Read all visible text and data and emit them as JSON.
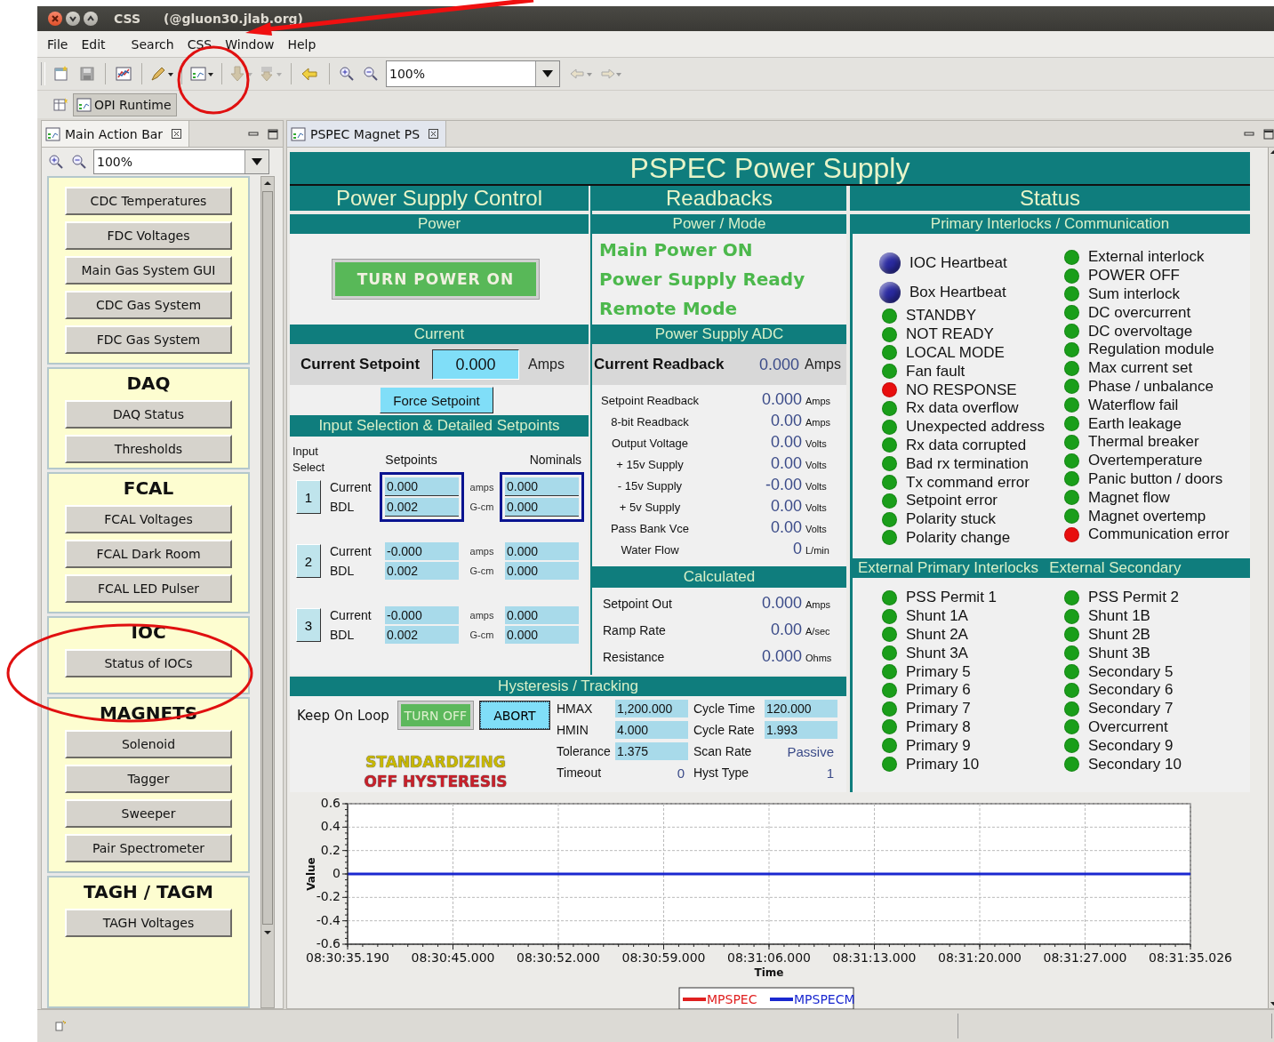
{
  "window": {
    "title": "CSS",
    "host": "(@gluon30.jlab.org)"
  },
  "menu": [
    "File",
    "Edit",
    "Search",
    "CSS",
    "Window",
    "Help"
  ],
  "toolbar": {
    "zoom": "100%"
  },
  "perspective": {
    "label": "OPI Runtime",
    "selected": true
  },
  "left_view": {
    "tab": "Main Action Bar",
    "zoom": "100%",
    "sections": [
      {
        "items": [
          "CDC Temperatures",
          "FDC Voltages",
          "Main Gas System GUI",
          "CDC Gas System",
          "FDC Gas System"
        ]
      },
      {
        "title": "DAQ",
        "items": [
          "DAQ Status",
          "Thresholds"
        ]
      },
      {
        "title": "FCAL",
        "items": [
          "FCAL Voltages",
          "FCAL Dark Room",
          "FCAL LED Pulser"
        ]
      },
      {
        "title": "IOC",
        "items": [
          "Status of IOCs"
        ]
      },
      {
        "title": "MAGNETS",
        "items": [
          "Solenoid",
          "Tagger",
          "Sweeper",
          "Pair Spectrometer"
        ]
      },
      {
        "title": "TAGH / TAGM",
        "items": [
          "TAGH Voltages"
        ]
      }
    ]
  },
  "editor": {
    "tab": "PSPEC Magnet PS",
    "title": "PSPEC Power Supply",
    "control": {
      "header": "Power Supply Control",
      "power_header": "Power",
      "power_button": "TURN POWER ON",
      "current_header": "Current",
      "setpoint_label": "Current Setpoint",
      "setpoint_value": "0.000",
      "setpoint_unit": "Amps",
      "force_button": "Force Setpoint",
      "input_header": "Input Selection & Detailed Setpoints",
      "input_select_label": "Input Select",
      "setpoints_label": "Setpoints",
      "nominals_label": "Nominals",
      "inputs": [
        {
          "button": "1",
          "selected": true,
          "rows": [
            {
              "label": "Current",
              "setpoint": "0.000",
              "unit": "amps",
              "nominal": "0.000"
            },
            {
              "label": "BDL",
              "setpoint": "0.002",
              "unit": "G-cm",
              "nominal": "0.000"
            }
          ]
        },
        {
          "button": "2",
          "selected": false,
          "rows": [
            {
              "label": "Current",
              "setpoint": "-0.000",
              "unit": "amps",
              "nominal": "0.000"
            },
            {
              "label": "BDL",
              "setpoint": "0.002",
              "unit": "G-cm",
              "nominal": "0.000"
            }
          ]
        },
        {
          "button": "3",
          "selected": false,
          "rows": [
            {
              "label": "Current",
              "setpoint": "-0.000",
              "unit": "amps",
              "nominal": "0.000"
            },
            {
              "label": "BDL",
              "setpoint": "0.002",
              "unit": "G-cm",
              "nominal": "0.000"
            }
          ]
        }
      ]
    },
    "readbacks": {
      "header": "Readbacks",
      "mode_header": "Power / Mode",
      "modes": [
        "Main Power ON",
        "Power Supply Ready",
        "Remote Mode"
      ],
      "adc_header": "Power Supply ADC",
      "readback_label": "Current Readback",
      "readback_value": "0.000",
      "readback_unit": "Amps",
      "readings": [
        {
          "label": "Setpoint Readback",
          "value": "0.000",
          "unit": "Amps"
        },
        {
          "label": "8-bit Readback",
          "value": "0.00",
          "unit": "Amps"
        },
        {
          "label": "Output Voltage",
          "value": "0.00",
          "unit": "Volts"
        },
        {
          "label": "+ 15v Supply",
          "value": "0.00",
          "unit": "Volts"
        },
        {
          "label": "- 15v Supply",
          "value": "-0.00",
          "unit": "Volts"
        },
        {
          "label": "+ 5v Supply",
          "value": "0.00",
          "unit": "Volts"
        },
        {
          "label": "Pass Bank Vce",
          "value": "0.00",
          "unit": "Volts"
        },
        {
          "label": "Water Flow",
          "value": "0",
          "unit": "L/min"
        }
      ],
      "calc_header": "Calculated",
      "calculated": [
        {
          "label": "Setpoint Out",
          "value": "0.000",
          "unit": "Amps"
        },
        {
          "label": "Ramp Rate",
          "value": "0.00",
          "unit": "A/sec"
        },
        {
          "label": "Resistance",
          "value": "0.000",
          "unit": "Ohms"
        }
      ]
    },
    "hysteresis": {
      "header": "Hysteresis / Tracking",
      "loop_label": "Keep On Loop",
      "turn_off_button": "TURN OFF",
      "abort_button": "ABORT",
      "states": [
        {
          "text": "STANDARDIZING",
          "color": "#c8b800"
        },
        {
          "text": "OFF HYSTERESIS",
          "color": "#c8202a"
        }
      ],
      "params": [
        {
          "label": "HMAX",
          "value": "1,200.000",
          "kind": "field"
        },
        {
          "label": "Cycle Time",
          "value": "120.000",
          "kind": "field"
        },
        {
          "label": "HMIN",
          "value": "4.000",
          "kind": "field"
        },
        {
          "label": "Cycle Rate",
          "value": "1.993",
          "kind": "field"
        },
        {
          "label": "Tolerance",
          "value": "1.375",
          "kind": "field"
        },
        {
          "label": "Scan Rate",
          "value": "Passive",
          "kind": "readout"
        },
        {
          "label": "Timeout",
          "value": "0",
          "kind": "readout"
        },
        {
          "label": "Hyst Type",
          "value": "1",
          "kind": "readout"
        }
      ]
    },
    "status": {
      "header": "Status",
      "primary_header": "Primary Interlocks / Communication",
      "primary_left": [
        {
          "label": "IOC Heartbeat",
          "kind": "heartbeat",
          "color": "#2a2aa0"
        },
        {
          "label": "Box Heartbeat",
          "kind": "heartbeat",
          "color": "#2a2aa0"
        },
        {
          "label": "STANDBY",
          "kind": "led",
          "color": "#1a9e1a"
        },
        {
          "label": "NOT READY",
          "kind": "led",
          "color": "#1a9e1a"
        },
        {
          "label": "LOCAL MODE",
          "kind": "led",
          "color": "#1a9e1a"
        },
        {
          "label": "Fan fault",
          "kind": "led",
          "color": "#1a9e1a"
        },
        {
          "label": "NO RESPONSE",
          "kind": "led",
          "color": "#e80e0e"
        },
        {
          "label": "Rx data overflow",
          "kind": "led",
          "color": "#1a9e1a"
        },
        {
          "label": "Unexpected address",
          "kind": "led",
          "color": "#1a9e1a"
        },
        {
          "label": "Rx data corrupted",
          "kind": "led",
          "color": "#1a9e1a"
        },
        {
          "label": "Bad rx termination",
          "kind": "led",
          "color": "#1a9e1a"
        },
        {
          "label": "Tx command error",
          "kind": "led",
          "color": "#1a9e1a"
        },
        {
          "label": "Setpoint error",
          "kind": "led",
          "color": "#1a9e1a"
        },
        {
          "label": "Polarity stuck",
          "kind": "led",
          "color": "#1a9e1a"
        },
        {
          "label": "Polarity change",
          "kind": "led",
          "color": "#1a9e1a"
        }
      ],
      "primary_right": [
        {
          "label": "External interlock",
          "color": "#1a9e1a"
        },
        {
          "label": "POWER OFF",
          "color": "#1a9e1a"
        },
        {
          "label": "Sum interlock",
          "color": "#1a9e1a"
        },
        {
          "label": "DC overcurrent",
          "color": "#1a9e1a"
        },
        {
          "label": "DC overvoltage",
          "color": "#1a9e1a"
        },
        {
          "label": "Regulation module",
          "color": "#1a9e1a"
        },
        {
          "label": "Max current set",
          "color": "#1a9e1a"
        },
        {
          "label": "Phase / unbalance",
          "color": "#1a9e1a"
        },
        {
          "label": "Waterflow fail",
          "color": "#1a9e1a"
        },
        {
          "label": "Earth leakage",
          "color": "#1a9e1a"
        },
        {
          "label": "Thermal breaker",
          "color": "#1a9e1a"
        },
        {
          "label": "Overtemperature",
          "color": "#1a9e1a"
        },
        {
          "label": "Panic button / doors",
          "color": "#1a9e1a"
        },
        {
          "label": "Magnet flow",
          "color": "#1a9e1a"
        },
        {
          "label": "Magnet overtemp",
          "color": "#1a9e1a"
        },
        {
          "label": "Communication error",
          "color": "#e80e0e"
        }
      ],
      "ext_headers": [
        "External Primary Interlocks",
        "External Secondary"
      ],
      "ext_left": [
        {
          "label": "PSS Permit 1",
          "color": "#1a9e1a"
        },
        {
          "label": "Shunt 1A",
          "color": "#1a9e1a"
        },
        {
          "label": "Shunt 2A",
          "color": "#1a9e1a"
        },
        {
          "label": "Shunt 3A",
          "color": "#1a9e1a"
        },
        {
          "label": "Primary 5",
          "color": "#1a9e1a"
        },
        {
          "label": "Primary 6",
          "color": "#1a9e1a"
        },
        {
          "label": "Primary 7",
          "color": "#1a9e1a"
        },
        {
          "label": "Primary 8",
          "color": "#1a9e1a"
        },
        {
          "label": "Primary 9",
          "color": "#1a9e1a"
        },
        {
          "label": "Primary 10",
          "color": "#1a9e1a"
        }
      ],
      "ext_right": [
        {
          "label": "PSS Permit 2",
          "color": "#1a9e1a"
        },
        {
          "label": "Shunt 1B",
          "color": "#1a9e1a"
        },
        {
          "label": "Shunt 2B",
          "color": "#1a9e1a"
        },
        {
          "label": "Shunt 3B",
          "color": "#1a9e1a"
        },
        {
          "label": "Secondary 5",
          "color": "#1a9e1a"
        },
        {
          "label": "Secondary 6",
          "color": "#1a9e1a"
        },
        {
          "label": "Secondary 7",
          "color": "#1a9e1a"
        },
        {
          "label": "Overcurrent",
          "color": "#1a9e1a"
        },
        {
          "label": "Secondary 9",
          "color": "#1a9e1a"
        },
        {
          "label": "Secondary 10",
          "color": "#1a9e1a"
        }
      ]
    },
    "chart": {
      "chart_data": {
        "type": "line",
        "grid": true,
        "legend": "bottom",
        "xlabel": "Time",
        "ylabel": "Value",
        "ylim": [
          -0.6,
          0.6
        ],
        "categories": [
          "08:30:35.190",
          "08:30:45.000",
          "08:30:52.000",
          "08:30:59.000",
          "08:31:06.000",
          "08:31:13.000",
          "08:31:20.000",
          "08:31:27.000",
          "08:31:35.026"
        ],
        "yticks": [
          -0.6,
          -0.4,
          -0.2,
          0,
          0.2,
          0.4,
          0.6
        ],
        "series": [
          {
            "name": "MPSPEC",
            "color": "#e02020",
            "values": [
              null,
              null,
              null,
              null,
              null,
              null,
              null,
              null,
              null
            ]
          },
          {
            "name": "MPSPECM",
            "color": "#1a28d0",
            "values": [
              0,
              0,
              0,
              0,
              0,
              0,
              0,
              0,
              0
            ]
          }
        ]
      }
    }
  }
}
